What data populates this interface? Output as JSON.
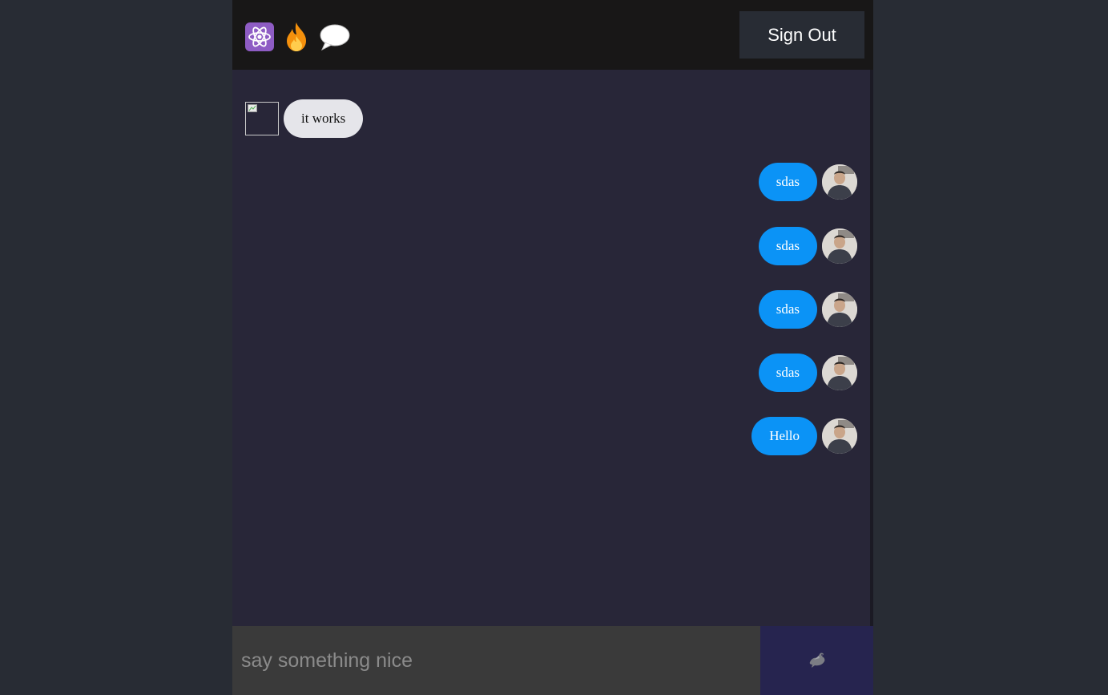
{
  "header": {
    "icons": [
      "atom-icon",
      "fire-icon",
      "speech-bubble-icon"
    ],
    "sign_out_label": "Sign Out"
  },
  "messages": [
    {
      "direction": "received",
      "text": "it works",
      "avatar": "broken-image"
    },
    {
      "direction": "sent",
      "text": "sdas",
      "avatar": "user-photo"
    },
    {
      "direction": "sent",
      "text": "sdas",
      "avatar": "user-photo"
    },
    {
      "direction": "sent",
      "text": "sdas",
      "avatar": "user-photo"
    },
    {
      "direction": "sent",
      "text": "sdas",
      "avatar": "user-photo"
    },
    {
      "direction": "sent",
      "text": "Hello",
      "avatar": "user-photo"
    }
  ],
  "composer": {
    "placeholder": "say something nice",
    "value": "",
    "send_icon": "dove-icon"
  },
  "colors": {
    "page_bg": "#282c34",
    "header_bg": "#181717",
    "chat_bg": "#282638",
    "sent_bubble": "#0b93f6",
    "received_bubble": "#e5e5ea",
    "input_bg": "#3a3a3a",
    "send_bg": "#26244f"
  }
}
